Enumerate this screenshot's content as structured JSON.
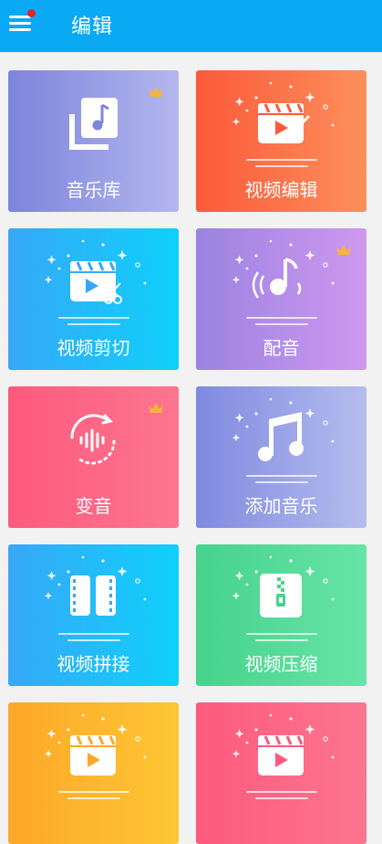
{
  "header": {
    "title": "编辑",
    "menu_icon": "hamburger-menu-icon",
    "notification_dot_color": "#e8202e",
    "background": "#09a9f4"
  },
  "cards": [
    {
      "label": "音乐库",
      "icon": "music-library-icon",
      "premium": true,
      "gradient": [
        "#7d84dc",
        "#b4b7ee"
      ]
    },
    {
      "label": "视频编辑",
      "icon": "video-edit-icon",
      "premium": false,
      "gradient": [
        "#fb5a3b",
        "#fd8f5c"
      ]
    },
    {
      "label": "视频剪切",
      "icon": "video-cut-icon",
      "premium": false,
      "gradient": [
        "#37a8f7",
        "#0fd0fb"
      ]
    },
    {
      "label": "配音",
      "icon": "dubbing-icon",
      "premium": true,
      "gradient": [
        "#9b83e2",
        "#cf98ef"
      ]
    },
    {
      "label": "变音",
      "icon": "voice-change-icon",
      "premium": true,
      "gradient": [
        "#fd5a7d",
        "#fd7590"
      ]
    },
    {
      "label": "添加音乐",
      "icon": "add-music-icon",
      "premium": false,
      "gradient": [
        "#7f8ae0",
        "#b5bdee"
      ]
    },
    {
      "label": "视频拼接",
      "icon": "video-merge-icon",
      "premium": false,
      "gradient": [
        "#37a8f7",
        "#0fd0fb"
      ]
    },
    {
      "label": "视频压缩",
      "icon": "video-compress-icon",
      "premium": false,
      "gradient": [
        "#46d38c",
        "#67e4a7"
      ]
    },
    {
      "label": "",
      "icon": "video-icon",
      "premium": false,
      "gradient": [
        "#fda72a",
        "#fdc733"
      ]
    },
    {
      "label": "",
      "icon": "video-icon",
      "premium": false,
      "gradient": [
        "#fd5a7d",
        "#fd7590"
      ]
    }
  ],
  "crown_color": "#f7b43a"
}
